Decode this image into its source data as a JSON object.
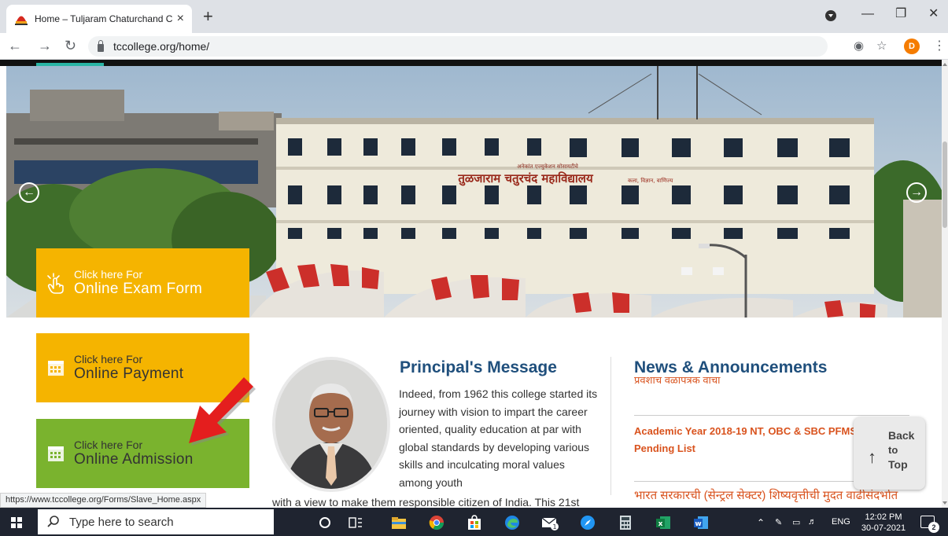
{
  "browser": {
    "tab_title": "Home – Tuljaram Chaturchand C",
    "tab_close": "×",
    "new_tab": "+",
    "url": "tccollege.org/home/",
    "avatar_letter": "D",
    "status_url": "https://www.tccollege.org/Forms/Slave_Home.aspx"
  },
  "hero": {
    "building_sign_small": "अनेकांत एज्युकेशन सोसायटीचे",
    "building_sign": "तुळजाराम चतुरचंद महाविद्यालय",
    "building_sign_sub": "कला, विज्ञान, वाणिज्य",
    "prev_arrow": "←",
    "next_arrow": "→"
  },
  "quick_links": {
    "exam": {
      "small": "Click here For",
      "big": "Online Exam Form"
    },
    "payment": {
      "small": "Click here For",
      "big": "Online Payment"
    },
    "admission": {
      "small": "Click here For",
      "big": "Online Admission"
    }
  },
  "principal": {
    "title": "Principal's Message",
    "text_narrow": "Indeed, from 1962 this college started its journey with vision to impart the career oriented, quality education at par with global standards by developing various skills and inculcating moral values among youth",
    "text_wide": "with a view to make them responsible citizen of India. This 21st"
  },
  "news": {
    "title": "News & Announcements",
    "clipped": "प्रवेशाचे वेळापत्रक वाचा",
    "items": [
      "Academic Year 2018-19 NT, OBC & SBC PFMS Pending List"
    ],
    "item_devanagari": "भारत सरकारची (सेन्ट्रल सेक्टर) शिष्यवृत्तीची मुदत वाढीसंदर्भात"
  },
  "back_to_top": {
    "line1": "Back",
    "line2": "to",
    "line3": "Top",
    "arrow": "↑"
  },
  "taskbar": {
    "search_placeholder": "Type here to search",
    "language": "ENG",
    "time": "12:02 PM",
    "date": "30-07-2021",
    "notification_count": "2",
    "mail_badge": "1"
  },
  "colors": {
    "exam_button": "#f5b400",
    "payment_button": "#f5b400",
    "admission_button": "#7ab32e",
    "heading_blue": "#1f4f7c",
    "news_orange": "#d9531e",
    "taskbar": "#1f2430"
  }
}
